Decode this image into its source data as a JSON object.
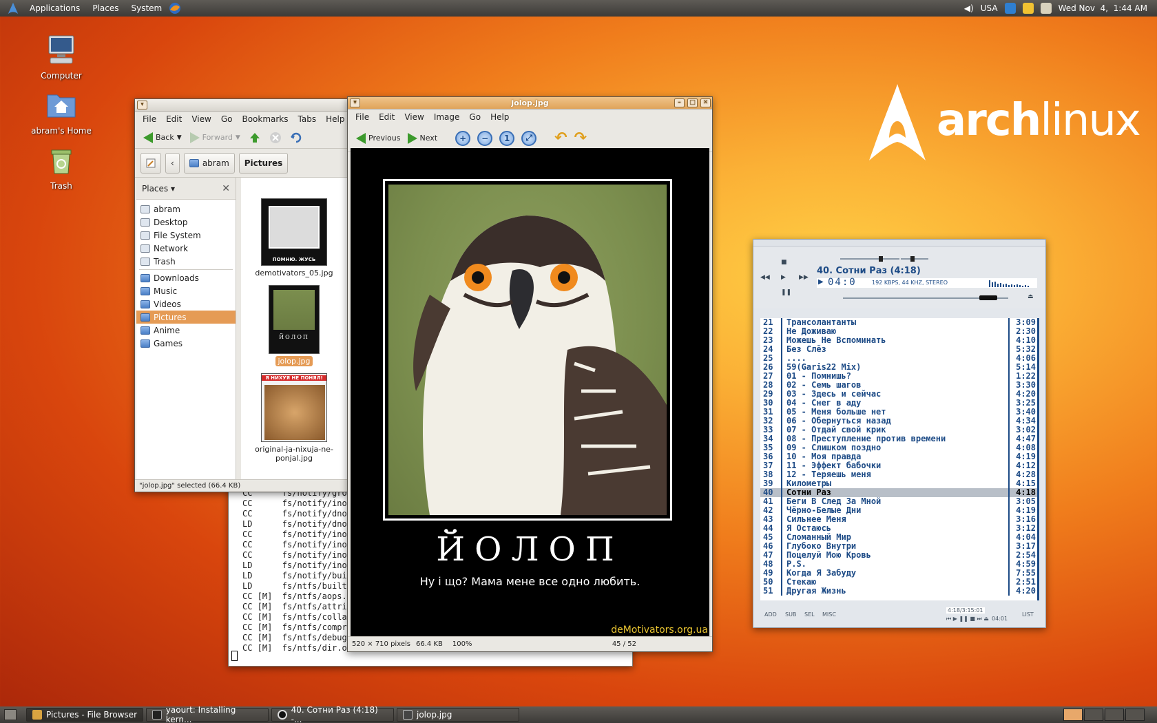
{
  "top_panel": {
    "menus": [
      "Applications",
      "Places",
      "System"
    ],
    "keyboard_layout": "USA",
    "clock": "Wed Nov  4,  1:44 AM"
  },
  "desktop_icons": [
    {
      "label": "Computer"
    },
    {
      "label": "abram's Home"
    },
    {
      "label": "Trash"
    }
  ],
  "arch_logo": {
    "word_bold": "arch",
    "word_light": "linux",
    "tm": "™"
  },
  "file_browser": {
    "menu": [
      "File",
      "Edit",
      "View",
      "Go",
      "Bookmarks",
      "Tabs",
      "Help"
    ],
    "back_label": "Back",
    "forward_label": "Forward",
    "path": [
      "abram",
      "Pictures"
    ],
    "places_label": "Places",
    "places": [
      "abram",
      "Desktop",
      "File System",
      "Network",
      "Trash"
    ],
    "bookmarks": [
      "Downloads",
      "Music",
      "Videos",
      "Pictures",
      "Anime",
      "Games"
    ],
    "files": [
      {
        "name": "demotivators_05.jpg",
        "caption": "ПОМНЮ. ЖУСЬ"
      },
      {
        "name": "jolop.jpg",
        "caption": "ЙОЛОП"
      },
      {
        "name": "original-ja-nixuja-ne-ponjal.jpg",
        "caption": "Я НИХУЯ НЕ ПОНЯЛ!"
      }
    ],
    "status": "\"jolop.jpg\" selected (66.4 KB)"
  },
  "terminal": {
    "lines": [
      "CC      fs/notify/grou",
      "CC      fs/notify/inoc",
      "CC      fs/notify/dnot",
      "LD      fs/notify/dnot",
      "CC      fs/notify/inot",
      "CC      fs/notify/inot",
      "CC      fs/notify/inot",
      "LD      fs/notify/inot",
      "LD      fs/notify/buil",
      "LD      fs/ntfs/built-",
      "CC [M]  fs/ntfs/aops.c",
      "CC [M]  fs/ntfs/attrib",
      "CC [M]  fs/ntfs/collat",
      "CC [M]  fs/ntfs/compre",
      "CC [M]  fs/ntfs/debug.",
      "CC [M]  fs/ntfs/dir.o"
    ]
  },
  "image_viewer": {
    "title": "jolop.jpg",
    "menu": [
      "File",
      "Edit",
      "View",
      "Image",
      "Go",
      "Help"
    ],
    "previous_label": "Previous",
    "next_label": "Next",
    "poster_title": "ЙОЛОП",
    "poster_subtitle": "Ну і що? Мама мене все одно любить.",
    "poster_site": "deMotivators.org.ua",
    "status_size": "520 × 710 pixels",
    "status_filesize": "66.4 KB",
    "status_zoom": "100%",
    "status_position": "45 / 52"
  },
  "player": {
    "now_playing": "40. Сотни Раз (4:18)",
    "time": "04:0",
    "info": "192 KBPS, 44 KHZ, STEREO",
    "foot_buttons": [
      "ADD",
      "SUB",
      "SEL",
      "MISC"
    ],
    "foot_list": "LIST",
    "total_time": "4:18/3:15:01",
    "elapsed": "04:01",
    "current_track": "40",
    "tracks": [
      {
        "n": "21",
        "t": "Трансолантанты",
        "d": "3:09"
      },
      {
        "n": "22",
        "t": "Не Доживаю",
        "d": "2:30"
      },
      {
        "n": "23",
        "t": "Можешь Не Вспоминать",
        "d": "4:10"
      },
      {
        "n": "24",
        "t": "Без Слёз",
        "d": "5:32"
      },
      {
        "n": "25",
        "t": "....",
        "d": "4:06"
      },
      {
        "n": "26",
        "t": "59(Garis22 Mix)",
        "d": "5:14"
      },
      {
        "n": "27",
        "t": "01 - Помнишь?",
        "d": "1:22"
      },
      {
        "n": "28",
        "t": "02 -  Семь шагов",
        "d": "3:30"
      },
      {
        "n": "29",
        "t": "03 - Здесь и сейчас",
        "d": "4:20"
      },
      {
        "n": "30",
        "t": "04 - Снег в аду",
        "d": "3:25"
      },
      {
        "n": "31",
        "t": "05 - Меня больше нет",
        "d": "3:40"
      },
      {
        "n": "32",
        "t": "06 - Обернуться назад",
        "d": "4:34"
      },
      {
        "n": "33",
        "t": "07 - Отдай свой крик",
        "d": "3:02"
      },
      {
        "n": "34",
        "t": "08 - Преступление против времени",
        "d": "4:47"
      },
      {
        "n": "35",
        "t": "09 - Слишком поздно",
        "d": "4:08"
      },
      {
        "n": "36",
        "t": "10 - Моя правда",
        "d": "4:19"
      },
      {
        "n": "37",
        "t": "11 - Эффект бабочки",
        "d": "4:12"
      },
      {
        "n": "38",
        "t": "12 - Теряешь меня",
        "d": "4:28"
      },
      {
        "n": "39",
        "t": "Километры",
        "d": "4:15"
      },
      {
        "n": "40",
        "t": "Сотни Раз",
        "d": "4:18"
      },
      {
        "n": "41",
        "t": "Беги В След За Мной",
        "d": "3:05"
      },
      {
        "n": "42",
        "t": "Чёрно-Белые Дни",
        "d": "4:19"
      },
      {
        "n": "43",
        "t": "Сильнее Меня",
        "d": "3:16"
      },
      {
        "n": "44",
        "t": "Я Остаюсь",
        "d": "3:12"
      },
      {
        "n": "45",
        "t": "Сломанный Мир",
        "d": "4:04"
      },
      {
        "n": "46",
        "t": "Глубоко Внутри",
        "d": "3:17"
      },
      {
        "n": "47",
        "t": "Поцелуй Мою Кровь",
        "d": "2:54"
      },
      {
        "n": "48",
        "t": "P.S.",
        "d": "4:59"
      },
      {
        "n": "49",
        "t": "Когда Я Забуду",
        "d": "7:55"
      },
      {
        "n": "50",
        "t": "Стекаю",
        "d": "2:51"
      },
      {
        "n": "51",
        "t": "Другая Жизнь",
        "d": "4:20"
      }
    ]
  },
  "taskbar": {
    "tasks": [
      "Pictures - File Browser",
      "yaourt: Installing kern...",
      "40. Сотни Раз (4:18) -...",
      "jolop.jpg"
    ]
  },
  "colors": {
    "selection": "#e59b55",
    "player_text": "#1d4b86",
    "panel": "#3c3a37"
  }
}
